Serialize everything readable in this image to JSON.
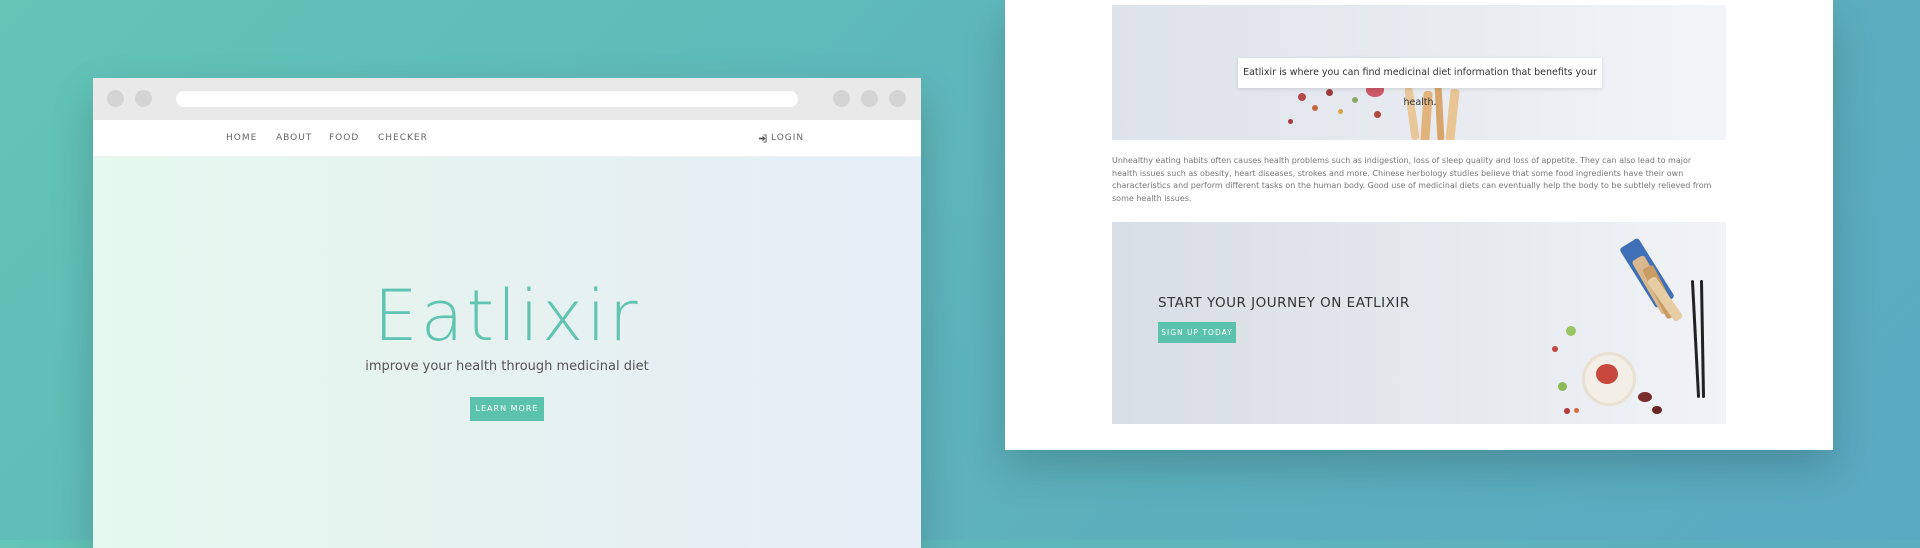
{
  "browser": {
    "nav": {
      "items": [
        {
          "label": "HOME"
        },
        {
          "label": "ABOUT"
        },
        {
          "label": "FOOD"
        },
        {
          "label": "CHECKER"
        }
      ],
      "login_label": "LOGIN"
    },
    "hero": {
      "title": "Eatlixir",
      "subtitle": "improve your health through medicinal diet",
      "button_label": "LEARN MORE"
    }
  },
  "page": {
    "banner_caption": "Eatlixir is where you can find medicinal diet information that benefits your health.",
    "body_text": "Unhealthy eating habits often causes health problems such as indigestion, loss of sleep quality and loss of appetite. They can also lead to major health issues such as obesity, heart diseases, strokes and more. Chinese herbology studies believe that some food ingredients have their own characteristics and perform different tasks on the human body. Good use of medicinal diets can eventually help the body to be subtlely relieved from some health issues.",
    "cta": {
      "title": "START YOUR JOURNEY ON EATLIXIR",
      "button_label": "SIGN UP TODAY"
    }
  },
  "colors": {
    "brand_teal": "#5bc2ad",
    "background": "#5db3bc"
  }
}
